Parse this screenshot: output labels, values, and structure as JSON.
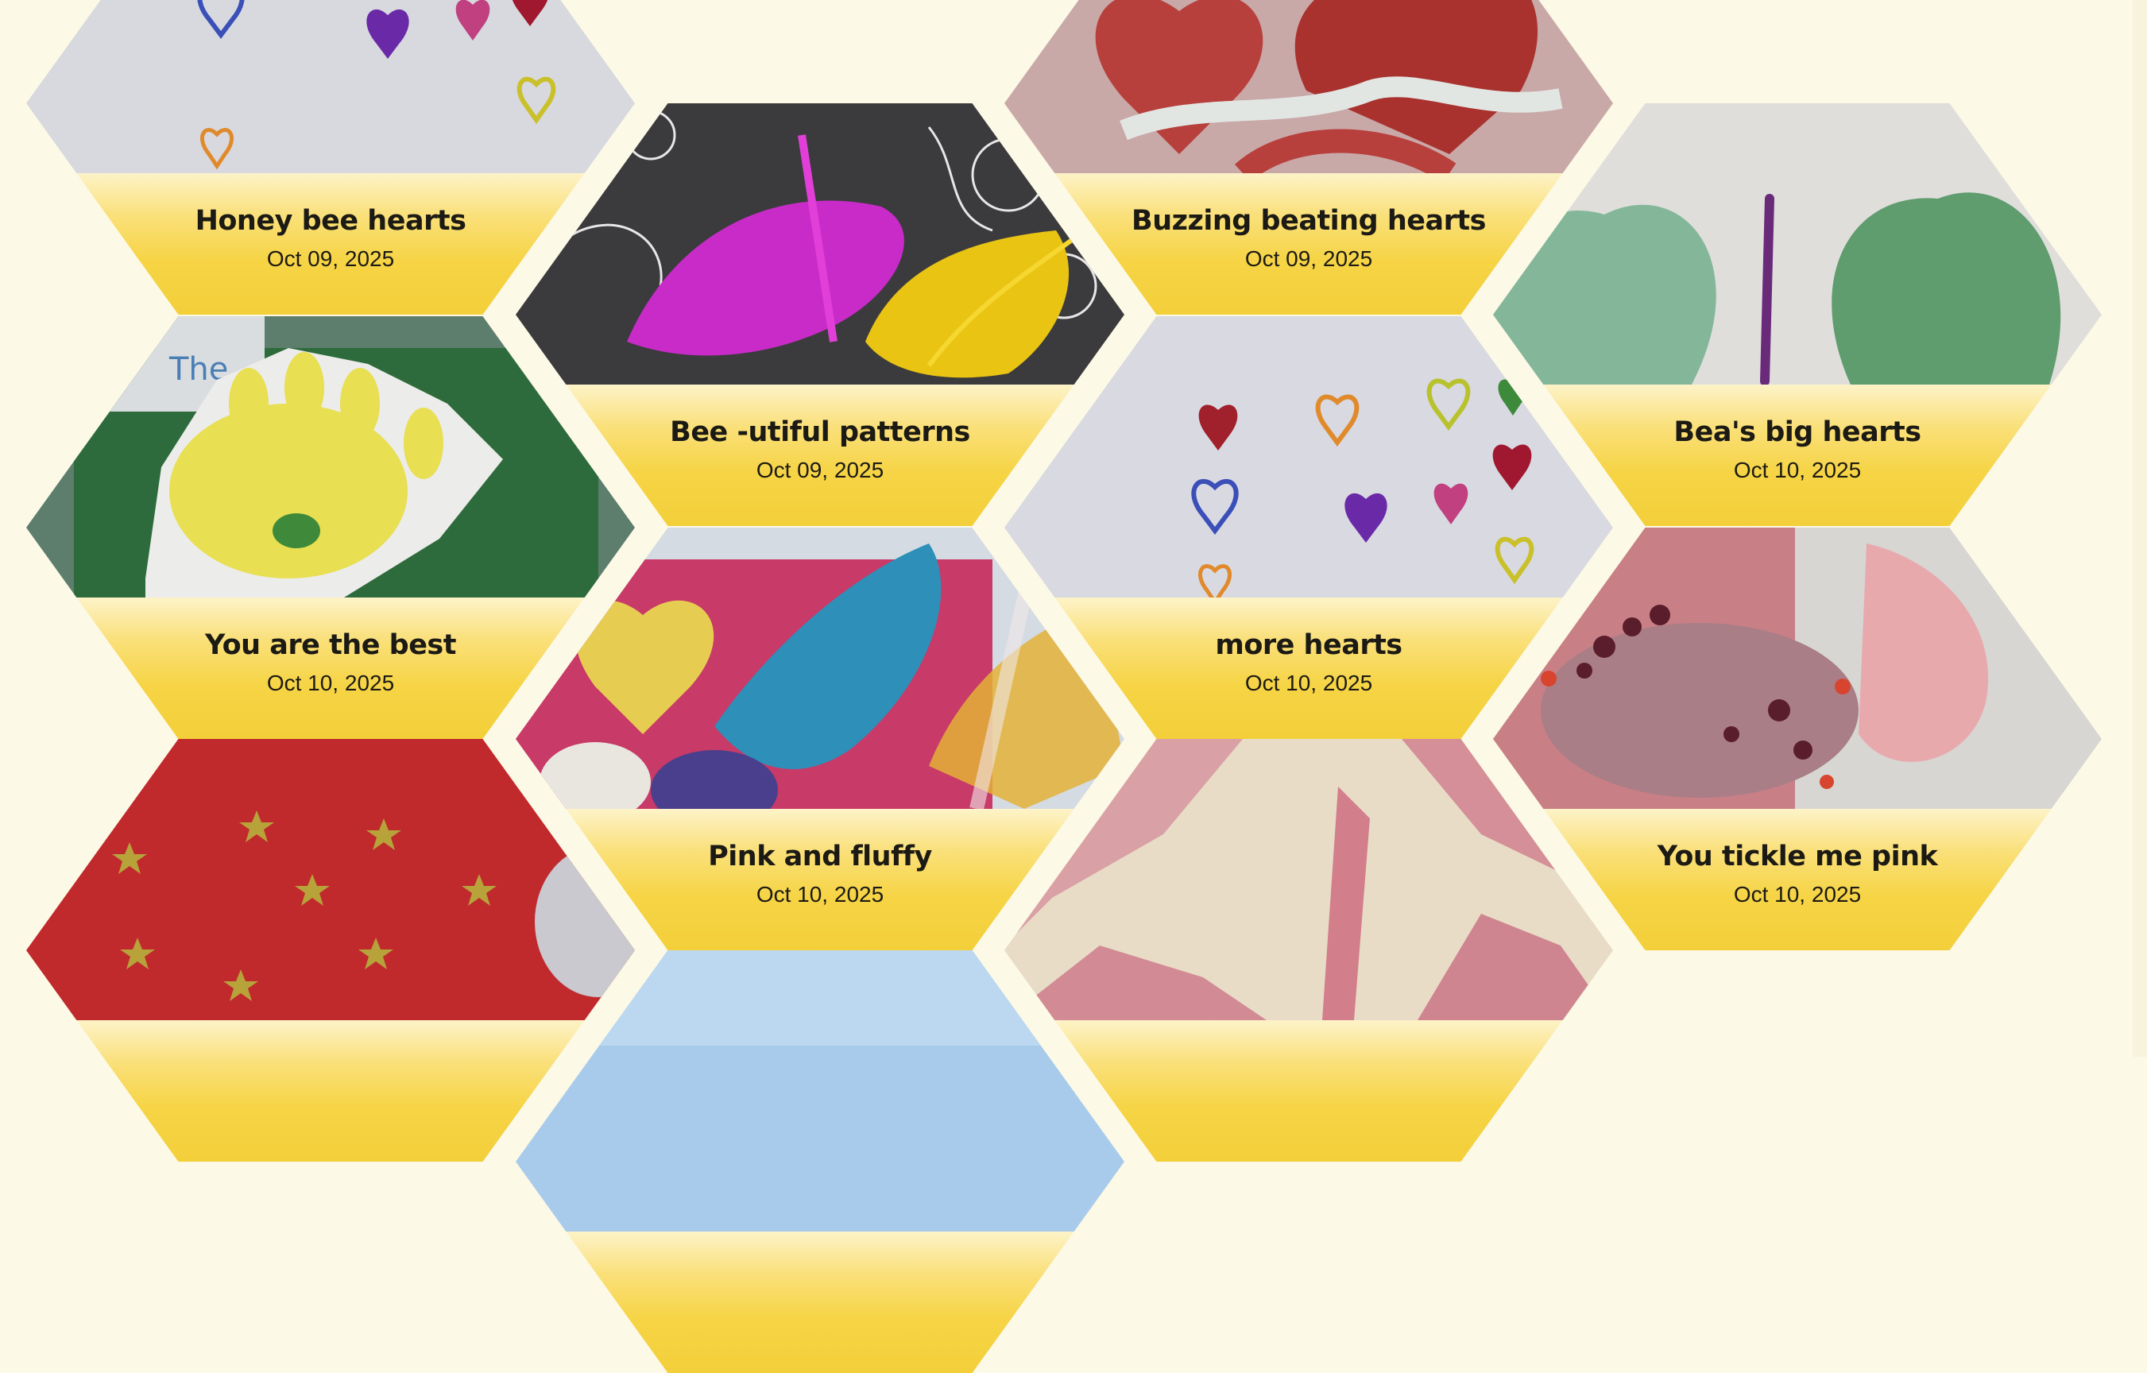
{
  "tiles": [
    {
      "id": "t1",
      "title": "Honey bee hearts",
      "date": "Oct 09, 2025",
      "image": "drawn-hearts-image"
    },
    {
      "id": "t2",
      "title": "Bee -utiful patterns",
      "date": "Oct 09, 2025",
      "image": "feathers-image"
    },
    {
      "id": "t3",
      "title": "Buzzing beating hearts",
      "date": "Oct 09, 2025",
      "image": "red-paint-hearts-image"
    },
    {
      "id": "t4",
      "title": "Bea's big hearts",
      "date": "Oct 10, 2025",
      "image": "felt-hearts-image"
    },
    {
      "id": "t5",
      "title": "You are the best",
      "date": "Oct 10, 2025",
      "image": "handprint-image"
    },
    {
      "id": "t6",
      "title": "more hearts",
      "date": "Oct 10, 2025",
      "image": "drawn-hearts-image"
    },
    {
      "id": "t7",
      "title": "Pink and fluffy",
      "date": "Oct 10, 2025",
      "image": "feather-collage-image"
    },
    {
      "id": "t8",
      "title": "You tickle me pink",
      "date": "Oct 10, 2025",
      "image": "pink-glitter-image"
    },
    {
      "id": "t9",
      "title": "",
      "date": "",
      "image": "red-star-card-image"
    },
    {
      "id": "t10",
      "title": "",
      "date": "",
      "image": "pink-paint-image"
    },
    {
      "id": "t11",
      "title": "",
      "date": "",
      "image": "blue-sky-image"
    }
  ],
  "colors": {
    "background": "#fcf9e6",
    "caption_yellow": "#f6d445",
    "text": "#1c1a14"
  }
}
